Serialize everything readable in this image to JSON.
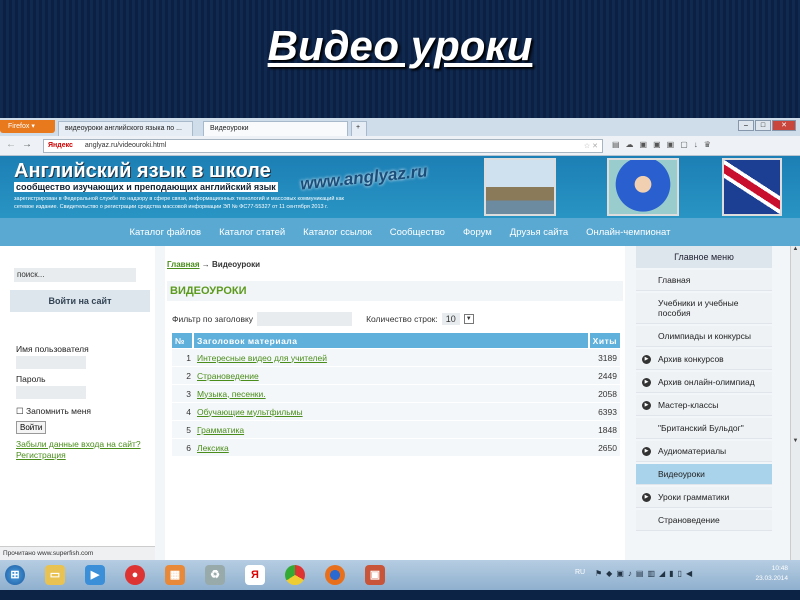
{
  "slide": {
    "title": "Видео уроки"
  },
  "browser": {
    "firefox_button": "Firefox ▾",
    "tabs": [
      {
        "label": "видеоуроки английского языка по ..."
      },
      {
        "label": "Видеоуроки"
      }
    ],
    "new_tab": "+",
    "url_brand": "Яндекс",
    "url": "anglyaz.ru/videouroki.html"
  },
  "banner": {
    "title": "Английский язык в школе",
    "subtitle": "сообщество изучающих и преподающих английский язык",
    "note_line1": "зарегистрирован в Федеральной службе по надзору в сфере связи, информационных технологий и массовых коммуникаций как",
    "note_line2": "сетевое издание. Свидетельство о регистрации средства массовой информации ЭЛ № ФС77-55327 от 11 сентября 2013 г.",
    "site": "www.anglyaz.ru"
  },
  "menu": [
    "Каталог файлов",
    "Каталог статей",
    "Каталог ссылок",
    "Сообщество",
    "Форум",
    "Друзья сайта",
    "Онлайн-чемпионат"
  ],
  "left": {
    "search_placeholder": "поиск...",
    "login_header": "Войти на сайт",
    "username_label": "Имя пользователя",
    "password_label": "Пароль",
    "remember_label": "Запомнить меня",
    "login_button": "Войти",
    "forgot_link": "Забыли данные входа на сайт?",
    "register_link": "Регистрация",
    "status": "Прочитано www.superfish.com"
  },
  "main": {
    "breadcrumb_home": "Главная",
    "breadcrumb_sep": "→",
    "breadcrumb_current": "Видеоуроки",
    "title": "ВИДЕОУРОКИ",
    "filter_label": "Фильтр по заголовку",
    "rows_label": "Количество строк:",
    "rows_value": "10",
    "columns": [
      "№",
      "Заголовок материала",
      "Хиты"
    ],
    "rows": [
      {
        "n": "1",
        "title": "Интересные видео для учителей",
        "hits": "3189"
      },
      {
        "n": "2",
        "title": "Страноведение",
        "hits": "2449"
      },
      {
        "n": "3",
        "title": "Музыка, песенки.",
        "hits": "2058"
      },
      {
        "n": "4",
        "title": "Обучающие мультфильмы",
        "hits": "6393"
      },
      {
        "n": "5",
        "title": "Грамматика",
        "hits": "1848"
      },
      {
        "n": "6",
        "title": "Лексика",
        "hits": "2650"
      }
    ]
  },
  "right": {
    "header": "Главное меню",
    "items": [
      "Главная",
      "Учебники и учебные пособия",
      "Олимпиады и конкурсы",
      "Архив конкурсов",
      "Архив онлайн-олимпиад",
      "Мастер-классы",
      "\"Британский Бульдог\"",
      "Аудиоматериалы",
      "Видеоуроки",
      "Уроки грамматики",
      "Страноведение"
    ]
  },
  "taskbar": {
    "lang": "RU",
    "time": "10:48",
    "date": "23.03.2014"
  }
}
